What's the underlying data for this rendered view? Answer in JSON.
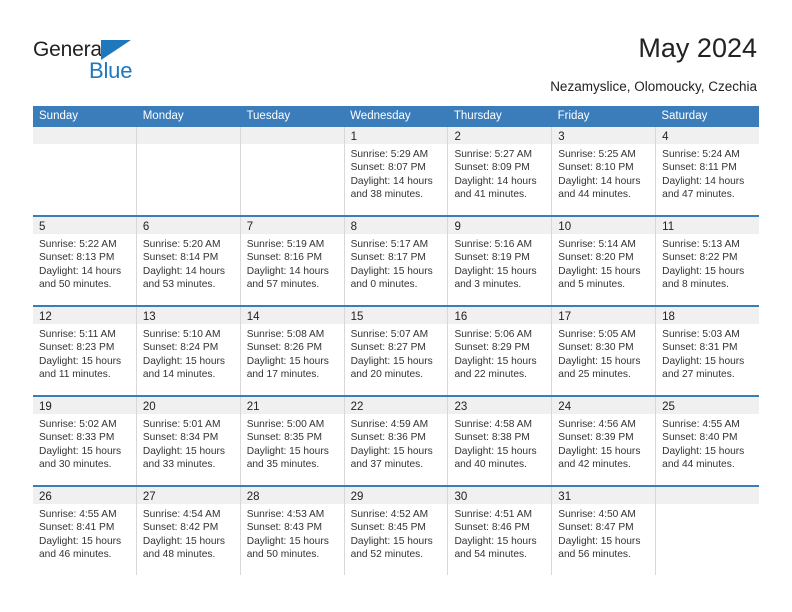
{
  "brand": {
    "name_top": "General",
    "name_bottom": "Blue",
    "accent_color": "#1f77bc"
  },
  "header": {
    "title": "May 2024",
    "subtitle": "Nezamyslice, Olomoucky, Czechia"
  },
  "theme": {
    "header_blue": "#3a7dba",
    "daynum_band": "#f0f0f0",
    "cell_border": "#d8d8d8"
  },
  "weekdays": [
    "Sunday",
    "Monday",
    "Tuesday",
    "Wednesday",
    "Thursday",
    "Friday",
    "Saturday"
  ],
  "weeks": [
    [
      {
        "day": "",
        "empty": true
      },
      {
        "day": "",
        "empty": true
      },
      {
        "day": "",
        "empty": true
      },
      {
        "day": "1",
        "sunrise": "Sunrise: 5:29 AM",
        "sunset": "Sunset: 8:07 PM",
        "daylight_1": "Daylight: 14 hours",
        "daylight_2": "and 38 minutes."
      },
      {
        "day": "2",
        "sunrise": "Sunrise: 5:27 AM",
        "sunset": "Sunset: 8:09 PM",
        "daylight_1": "Daylight: 14 hours",
        "daylight_2": "and 41 minutes."
      },
      {
        "day": "3",
        "sunrise": "Sunrise: 5:25 AM",
        "sunset": "Sunset: 8:10 PM",
        "daylight_1": "Daylight: 14 hours",
        "daylight_2": "and 44 minutes."
      },
      {
        "day": "4",
        "sunrise": "Sunrise: 5:24 AM",
        "sunset": "Sunset: 8:11 PM",
        "daylight_1": "Daylight: 14 hours",
        "daylight_2": "and 47 minutes."
      }
    ],
    [
      {
        "day": "5",
        "sunrise": "Sunrise: 5:22 AM",
        "sunset": "Sunset: 8:13 PM",
        "daylight_1": "Daylight: 14 hours",
        "daylight_2": "and 50 minutes."
      },
      {
        "day": "6",
        "sunrise": "Sunrise: 5:20 AM",
        "sunset": "Sunset: 8:14 PM",
        "daylight_1": "Daylight: 14 hours",
        "daylight_2": "and 53 minutes."
      },
      {
        "day": "7",
        "sunrise": "Sunrise: 5:19 AM",
        "sunset": "Sunset: 8:16 PM",
        "daylight_1": "Daylight: 14 hours",
        "daylight_2": "and 57 minutes."
      },
      {
        "day": "8",
        "sunrise": "Sunrise: 5:17 AM",
        "sunset": "Sunset: 8:17 PM",
        "daylight_1": "Daylight: 15 hours",
        "daylight_2": "and 0 minutes."
      },
      {
        "day": "9",
        "sunrise": "Sunrise: 5:16 AM",
        "sunset": "Sunset: 8:19 PM",
        "daylight_1": "Daylight: 15 hours",
        "daylight_2": "and 3 minutes."
      },
      {
        "day": "10",
        "sunrise": "Sunrise: 5:14 AM",
        "sunset": "Sunset: 8:20 PM",
        "daylight_1": "Daylight: 15 hours",
        "daylight_2": "and 5 minutes."
      },
      {
        "day": "11",
        "sunrise": "Sunrise: 5:13 AM",
        "sunset": "Sunset: 8:22 PM",
        "daylight_1": "Daylight: 15 hours",
        "daylight_2": "and 8 minutes."
      }
    ],
    [
      {
        "day": "12",
        "sunrise": "Sunrise: 5:11 AM",
        "sunset": "Sunset: 8:23 PM",
        "daylight_1": "Daylight: 15 hours",
        "daylight_2": "and 11 minutes."
      },
      {
        "day": "13",
        "sunrise": "Sunrise: 5:10 AM",
        "sunset": "Sunset: 8:24 PM",
        "daylight_1": "Daylight: 15 hours",
        "daylight_2": "and 14 minutes."
      },
      {
        "day": "14",
        "sunrise": "Sunrise: 5:08 AM",
        "sunset": "Sunset: 8:26 PM",
        "daylight_1": "Daylight: 15 hours",
        "daylight_2": "and 17 minutes."
      },
      {
        "day": "15",
        "sunrise": "Sunrise: 5:07 AM",
        "sunset": "Sunset: 8:27 PM",
        "daylight_1": "Daylight: 15 hours",
        "daylight_2": "and 20 minutes."
      },
      {
        "day": "16",
        "sunrise": "Sunrise: 5:06 AM",
        "sunset": "Sunset: 8:29 PM",
        "daylight_1": "Daylight: 15 hours",
        "daylight_2": "and 22 minutes."
      },
      {
        "day": "17",
        "sunrise": "Sunrise: 5:05 AM",
        "sunset": "Sunset: 8:30 PM",
        "daylight_1": "Daylight: 15 hours",
        "daylight_2": "and 25 minutes."
      },
      {
        "day": "18",
        "sunrise": "Sunrise: 5:03 AM",
        "sunset": "Sunset: 8:31 PM",
        "daylight_1": "Daylight: 15 hours",
        "daylight_2": "and 27 minutes."
      }
    ],
    [
      {
        "day": "19",
        "sunrise": "Sunrise: 5:02 AM",
        "sunset": "Sunset: 8:33 PM",
        "daylight_1": "Daylight: 15 hours",
        "daylight_2": "and 30 minutes."
      },
      {
        "day": "20",
        "sunrise": "Sunrise: 5:01 AM",
        "sunset": "Sunset: 8:34 PM",
        "daylight_1": "Daylight: 15 hours",
        "daylight_2": "and 33 minutes."
      },
      {
        "day": "21",
        "sunrise": "Sunrise: 5:00 AM",
        "sunset": "Sunset: 8:35 PM",
        "daylight_1": "Daylight: 15 hours",
        "daylight_2": "and 35 minutes."
      },
      {
        "day": "22",
        "sunrise": "Sunrise: 4:59 AM",
        "sunset": "Sunset: 8:36 PM",
        "daylight_1": "Daylight: 15 hours",
        "daylight_2": "and 37 minutes."
      },
      {
        "day": "23",
        "sunrise": "Sunrise: 4:58 AM",
        "sunset": "Sunset: 8:38 PM",
        "daylight_1": "Daylight: 15 hours",
        "daylight_2": "and 40 minutes."
      },
      {
        "day": "24",
        "sunrise": "Sunrise: 4:56 AM",
        "sunset": "Sunset: 8:39 PM",
        "daylight_1": "Daylight: 15 hours",
        "daylight_2": "and 42 minutes."
      },
      {
        "day": "25",
        "sunrise": "Sunrise: 4:55 AM",
        "sunset": "Sunset: 8:40 PM",
        "daylight_1": "Daylight: 15 hours",
        "daylight_2": "and 44 minutes."
      }
    ],
    [
      {
        "day": "26",
        "sunrise": "Sunrise: 4:55 AM",
        "sunset": "Sunset: 8:41 PM",
        "daylight_1": "Daylight: 15 hours",
        "daylight_2": "and 46 minutes."
      },
      {
        "day": "27",
        "sunrise": "Sunrise: 4:54 AM",
        "sunset": "Sunset: 8:42 PM",
        "daylight_1": "Daylight: 15 hours",
        "daylight_2": "and 48 minutes."
      },
      {
        "day": "28",
        "sunrise": "Sunrise: 4:53 AM",
        "sunset": "Sunset: 8:43 PM",
        "daylight_1": "Daylight: 15 hours",
        "daylight_2": "and 50 minutes."
      },
      {
        "day": "29",
        "sunrise": "Sunrise: 4:52 AM",
        "sunset": "Sunset: 8:45 PM",
        "daylight_1": "Daylight: 15 hours",
        "daylight_2": "and 52 minutes."
      },
      {
        "day": "30",
        "sunrise": "Sunrise: 4:51 AM",
        "sunset": "Sunset: 8:46 PM",
        "daylight_1": "Daylight: 15 hours",
        "daylight_2": "and 54 minutes."
      },
      {
        "day": "31",
        "sunrise": "Sunrise: 4:50 AM",
        "sunset": "Sunset: 8:47 PM",
        "daylight_1": "Daylight: 15 hours",
        "daylight_2": "and 56 minutes."
      },
      {
        "day": "",
        "empty": true
      }
    ]
  ]
}
